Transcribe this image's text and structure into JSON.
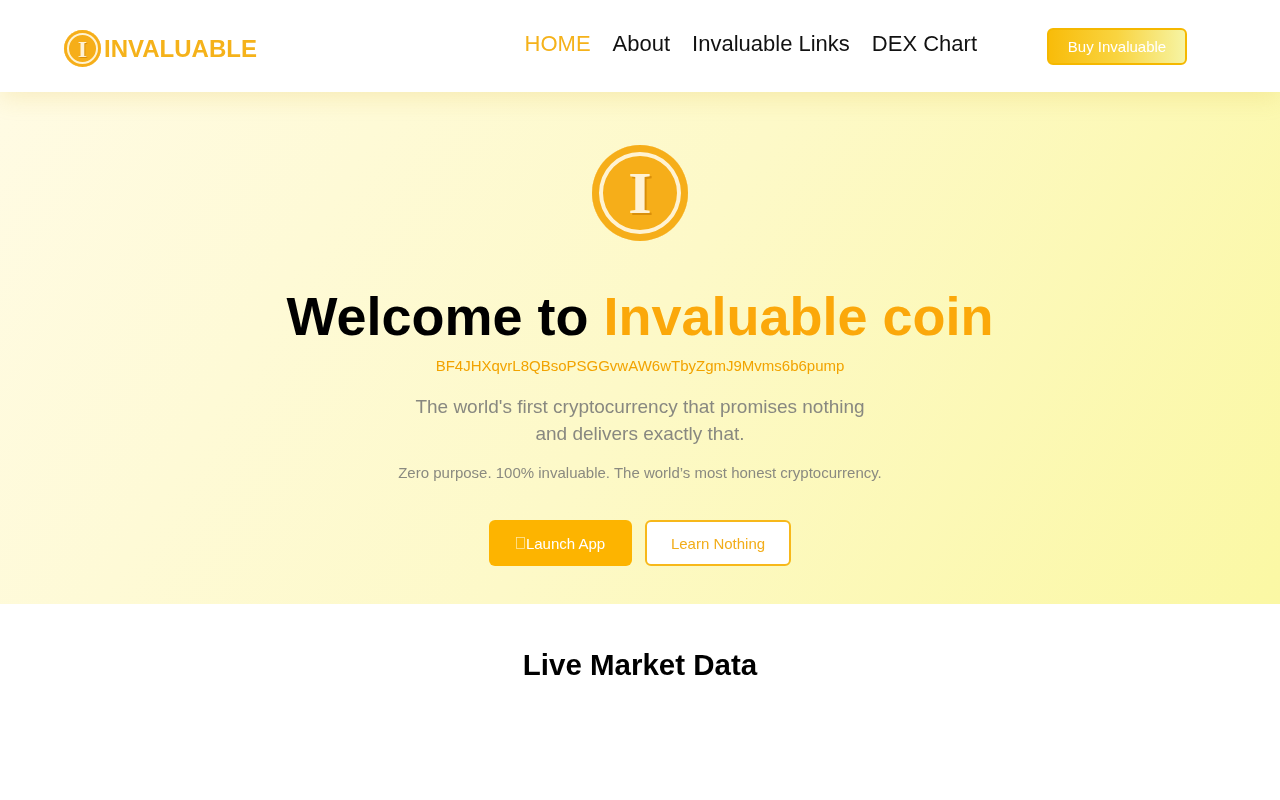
{
  "header": {
    "logo": {
      "emblem_letter": "I",
      "wordmark": "INVALUABLE"
    },
    "nav": [
      {
        "label": "HOME",
        "selected": true
      },
      {
        "label": "About",
        "selected": false
      },
      {
        "label": "Invaluable Links",
        "selected": false
      },
      {
        "label": "DEX Chart",
        "selected": false
      }
    ],
    "cta_button": "Buy Invaluable"
  },
  "hero": {
    "emblem_letter": "I",
    "heading": {
      "text": "Welcome to",
      "highlight": "Invaluable coin"
    },
    "contract_address": "BF4JHXqvrL8QBsoPSGGvwAW6wTbyZgmJ9Mvms6b6pump",
    "tagline": "The world's first cryptocurrency that promises nothing and delivers exactly that.",
    "subtagline": "Zero purpose. 100% invaluable. The world’s most honest cryptocurrency.",
    "buttons": [
      {
        "label": "Launch App",
        "kind": "primary"
      },
      {
        "label": "Learn Nothing",
        "kind": "outline"
      }
    ]
  },
  "market": {
    "title": "Live Market Data"
  }
}
